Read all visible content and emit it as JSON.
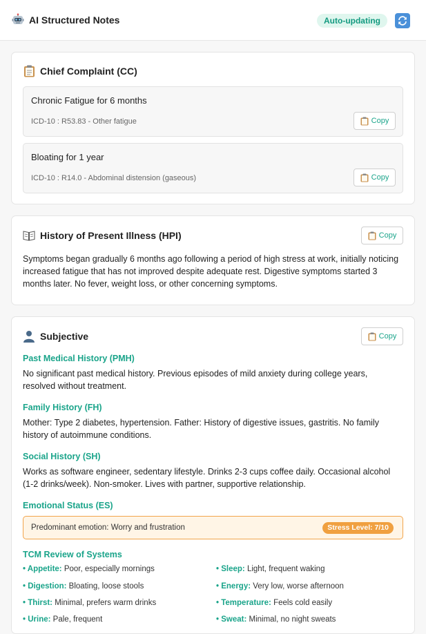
{
  "header": {
    "title": "AI Structured Notes",
    "status_badge": "Auto-updating",
    "app_icon": "robot-icon",
    "refresh_icon": "refresh-icon"
  },
  "copy_label": "Copy",
  "chief_complaint": {
    "title": "Chief Complaint (CC)",
    "icon": "clipboard-icon",
    "items": [
      {
        "name": "Chronic Fatigue for 6 months",
        "code": "ICD-10 : R53.83 - Other fatigue"
      },
      {
        "name": "Bloating for 1 year",
        "code": "ICD-10 : R14.0 - Abdominal distension (gaseous)"
      }
    ]
  },
  "hpi": {
    "title": "History of Present Illness (HPI)",
    "icon": "book-icon",
    "text": "Symptoms began gradually 6 months ago following a period of high stress at work, initially noticing increased fatigue that has not improved despite adequate rest. Digestive symptoms started 3 months later. No fever, weight loss, or other concerning symptoms."
  },
  "subjective": {
    "title": "Subjective",
    "icon": "person-icon",
    "pmh": {
      "heading": "Past Medical History (PMH)",
      "text": "No significant past medical history. Previous episodes of mild anxiety during college years, resolved without treatment."
    },
    "fh": {
      "heading": "Family History (FH)",
      "text": "Mother: Type 2 diabetes, hypertension. Father: History of digestive issues, gastritis. No family history of autoimmune conditions."
    },
    "sh": {
      "heading": "Social History (SH)",
      "text": "Works as software engineer, sedentary lifestyle. Drinks 2-3 cups coffee daily. Occasional alcohol (1-2 drinks/week). Non-smoker. Lives with partner, supportive relationship."
    },
    "es": {
      "heading": "Emotional Status (ES)",
      "text": "Predominant emotion: Worry and frustration",
      "stress": "Stress Level: 7/10"
    },
    "tcm": {
      "heading": "TCM Review of Systems",
      "items": [
        {
          "label": "Appetite:",
          "value": "Poor, especially mornings"
        },
        {
          "label": "Sleep:",
          "value": "Light, frequent waking"
        },
        {
          "label": "Digestion:",
          "value": "Bloating, loose stools"
        },
        {
          "label": "Energy:",
          "value": "Very low, worse afternoon"
        },
        {
          "label": "Thirst:",
          "value": "Minimal, prefers warm drinks"
        },
        {
          "label": "Temperature:",
          "value": "Feels cold easily"
        },
        {
          "label": "Urine:",
          "value": "Pale, frequent"
        },
        {
          "label": "Sweat:",
          "value": "Minimal, no night sweats"
        }
      ]
    }
  }
}
